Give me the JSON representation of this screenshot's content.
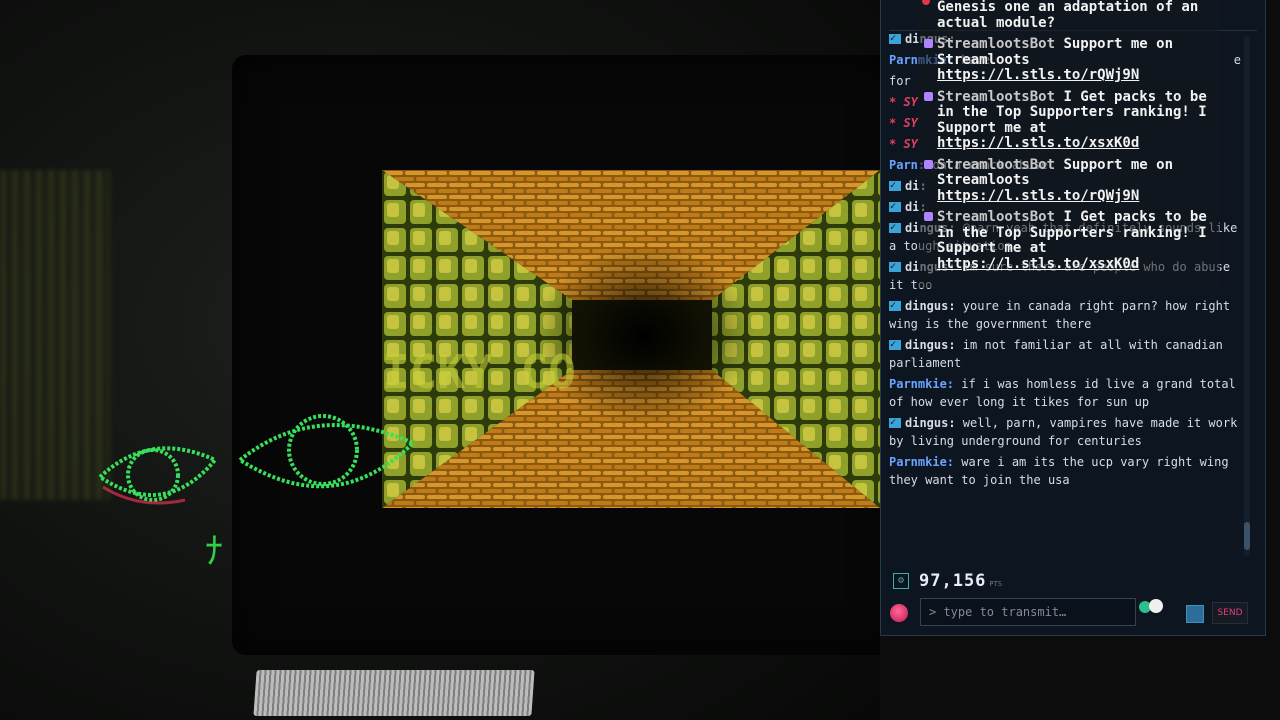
{
  "scene": {
    "overlay_glitch_text": "ICKY CO",
    "keyboard_glyph": "ﾅ"
  },
  "overlay": {
    "items": [
      {
        "icon": "streamloots-icon",
        "user": "",
        "text": "Genesis one an adaptation of an actual module?",
        "link": ""
      },
      {
        "icon": "streamloots-icon",
        "user": "StreamlootsBot",
        "text": "Support me on Streamloots",
        "link": "https://l.stls.to/rQWj9N"
      },
      {
        "icon": "streamloots-icon",
        "user": "StreamlootsBot",
        "text": "I Get packs to be in the Top Supporters ranking! I Support me at",
        "link": "https://l.stls.to/xsxK0d"
      },
      {
        "icon": "streamloots-icon",
        "user": "StreamlootsBot",
        "text": "Support me on Streamloots",
        "link": "https://l.stls.to/rQWj9N"
      },
      {
        "icon": "streamloots-icon",
        "user": "StreamlootsBot",
        "text": "I Get packs to be in the Top Supporters ranking! I Support me at",
        "link": "https://l.stls.to/xsxK0d"
      }
    ]
  },
  "chat": {
    "messages": [
      {
        "user": "dingus",
        "badge": true,
        "text": "",
        "cls": "dingus"
      },
      {
        "user": "Parnmkie",
        "badge": false,
        "text": "have",
        "cls": "parn",
        "trail": "e"
      },
      {
        "user": "",
        "badge": false,
        "text": "for",
        "cls": "plain"
      },
      {
        "user": "* SY",
        "badge": false,
        "text": "",
        "cls": "sys"
      },
      {
        "user": "* SY",
        "badge": false,
        "text": "",
        "cls": "sys"
      },
      {
        "user": "* SY",
        "badge": false,
        "text": "",
        "cls": "sys"
      },
      {
        "user": "Parn",
        "badge": false,
        "text": "on a crack abuse",
        "cls": "parn"
      },
      {
        "user": "di",
        "badge": true,
        "text": "",
        "cls": "dingus"
      },
      {
        "user": "di",
        "badge": true,
        "text": "",
        "cls": "dingus"
      },
      {
        "user": "dingus",
        "badge": true,
        "text": "@parn yeah that definitely sounds like a tough situation",
        "cls": "dingus"
      },
      {
        "user": "dingus",
        "badge": true,
        "text": "im sure there are people who do abuse it too",
        "cls": "dingus"
      },
      {
        "user": "dingus",
        "badge": true,
        "text": "youre in canada right parn? how right wing is the government there",
        "cls": "dingus"
      },
      {
        "user": "dingus",
        "badge": true,
        "text": "im not familiar at all with canadian parliament",
        "cls": "dingus"
      },
      {
        "user": "Parnmkie",
        "badge": false,
        "text": "if i was homless id live a grand total of how ever long it tikes for sun up",
        "cls": "parn"
      },
      {
        "user": "dingus",
        "badge": true,
        "text": "well, parn, vampires have made it work by living underground for centuries",
        "cls": "dingus"
      },
      {
        "user": "Parnmkie",
        "badge": false,
        "text": "ware i am its the ucp vary right wing they want to join the usa",
        "cls": "parn"
      }
    ],
    "points_value": "97,156",
    "points_unit": "PTS",
    "input_placeholder": "> type to transmit…",
    "send_label": "SEND"
  },
  "colors": {
    "accent": "#e0407a",
    "username_parn": "#6aa3ff",
    "badge": "#3aa3d8",
    "panel_bg": "#0d1520"
  }
}
